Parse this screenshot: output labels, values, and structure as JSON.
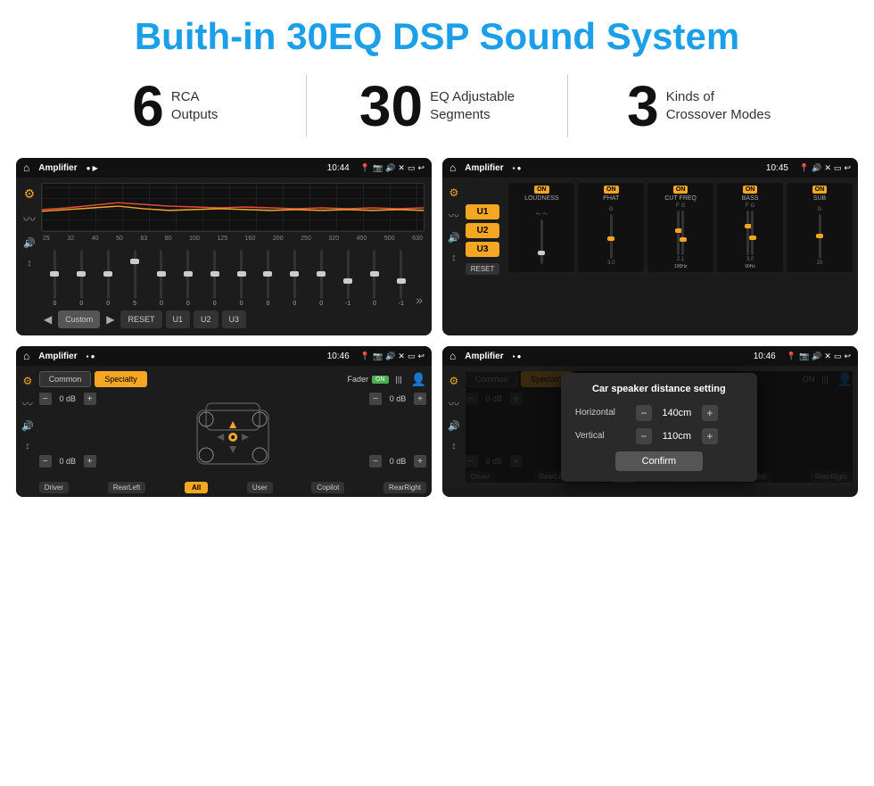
{
  "header": {
    "title": "Buith-in 30EQ DSP Sound System"
  },
  "stats": [
    {
      "number": "6",
      "line1": "RCA",
      "line2": "Outputs"
    },
    {
      "number": "30",
      "line1": "EQ Adjustable",
      "line2": "Segments"
    },
    {
      "number": "3",
      "line1": "Kinds of",
      "line2": "Crossover Modes"
    }
  ],
  "screens": {
    "top_left": {
      "status": {
        "title": "Amplifier",
        "time": "10:44"
      },
      "eq_labels": [
        "25",
        "32",
        "40",
        "50",
        "63",
        "80",
        "100",
        "125",
        "160",
        "200",
        "250",
        "320",
        "400",
        "500",
        "630"
      ],
      "eq_values": [
        "0",
        "0",
        "0",
        "5",
        "0",
        "0",
        "0",
        "0",
        "0",
        "0",
        "0",
        "-1",
        "0",
        "-1"
      ],
      "buttons": [
        "Custom",
        "RESET",
        "U1",
        "U2",
        "U3"
      ]
    },
    "top_right": {
      "status": {
        "title": "Amplifier",
        "time": "10:45"
      },
      "u_buttons": [
        "U1",
        "U2",
        "U3"
      ],
      "channels": [
        {
          "name": "LOUDNESS",
          "on": true
        },
        {
          "name": "PHAT",
          "on": true
        },
        {
          "name": "CUT FREQ",
          "on": true
        },
        {
          "name": "BASS",
          "on": true
        },
        {
          "name": "SUB",
          "on": true
        }
      ],
      "reset_label": "RESET"
    },
    "bottom_left": {
      "status": {
        "title": "Amplifier",
        "time": "10:46"
      },
      "tabs": [
        "Common",
        "Specialty"
      ],
      "active_tab": "Specialty",
      "fader_label": "Fader",
      "fader_on": "ON",
      "volumes": [
        "0 dB",
        "0 dB",
        "0 dB",
        "0 dB"
      ],
      "buttons": [
        "Driver",
        "Copilot",
        "RearLeft",
        "All",
        "User",
        "RearRight"
      ]
    },
    "bottom_right": {
      "status": {
        "title": "Amplifier",
        "time": "10:46"
      },
      "tabs": [
        "Common",
        "Specialty"
      ],
      "active_tab": "Specialty",
      "dialog": {
        "title": "Car speaker distance setting",
        "horizontal_label": "Horizontal",
        "horizontal_value": "140cm",
        "vertical_label": "Vertical",
        "vertical_value": "110cm",
        "confirm_label": "Confirm"
      },
      "volumes": [
        "0 dB",
        "0 dB"
      ],
      "buttons": [
        "Driver",
        "Copilot",
        "RearLeft",
        "All",
        "User",
        "RearRight"
      ]
    }
  },
  "icons": {
    "home": "⌂",
    "play": "▶",
    "prev": "◀",
    "camera": "📷",
    "speaker": "🔊",
    "close": "✕",
    "minus_icon": "□",
    "back": "↩",
    "location_pin": "📍",
    "eq_icon": "≡",
    "waveform": "〰",
    "arrows": "↕",
    "person": "👤"
  }
}
